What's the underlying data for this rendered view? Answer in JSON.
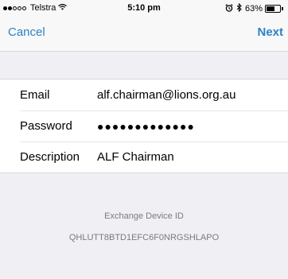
{
  "status_bar": {
    "carrier": "Telstra",
    "time": "5:10 pm",
    "battery": "63%",
    "battery_level": 0.63
  },
  "nav": {
    "cancel_label": "Cancel",
    "next_label": "Next"
  },
  "form": {
    "email_label": "Email",
    "email_value": "alf.chairman@lions.org.au",
    "password_label": "Password",
    "password_value": "●●●●●●●●●●●●●",
    "description_label": "Description",
    "description_value": "ALF Chairman"
  },
  "device": {
    "title": "Exchange Device ID",
    "id": "QHLUTT8BTD1EFC6F0NRGSHLAPO"
  },
  "colors": {
    "accent": "#2a82c8",
    "background": "#efeff4",
    "secondary_text": "#7a7a7f"
  }
}
